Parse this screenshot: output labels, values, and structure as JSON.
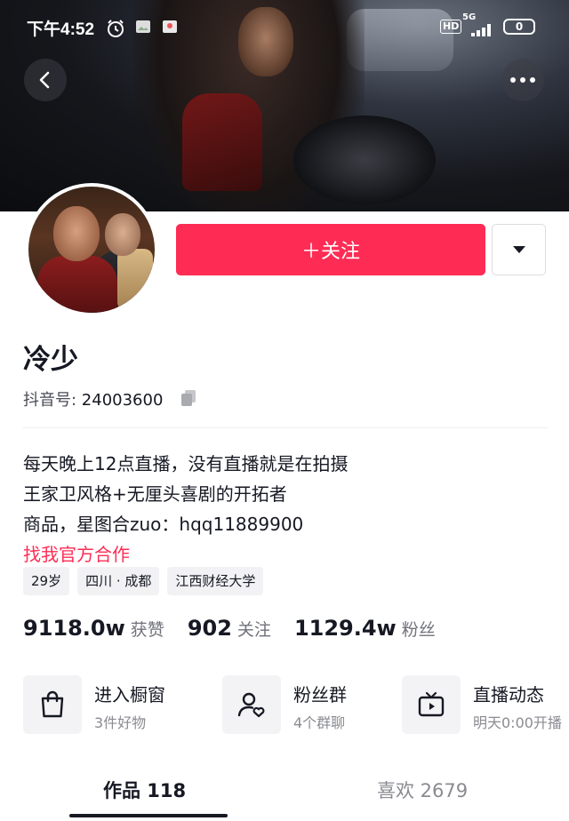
{
  "status_bar": {
    "time": "下午4:52",
    "network_badge": "HD",
    "signal_label": "5G",
    "battery": "0"
  },
  "header": {
    "back_icon": "chevron-left-icon",
    "more_icon": "more-horizontal-icon"
  },
  "profile": {
    "follow_label": "＋关注",
    "dropdown_icon": "caret-down-icon",
    "nickname": "冷少",
    "douyin_id_label": "抖音号: ",
    "douyin_id": "24003600",
    "bio_lines": [
      "每天晚上12点直播，没有直播就是在拍摄",
      "王家卫风格+无厘头喜剧的开拓者",
      "商品，星图合zuo：hqq11889900"
    ],
    "bio_link": "找我官方合作",
    "tags": [
      "29岁",
      "四川 · 成都",
      "江西财经大学"
    ]
  },
  "stats": {
    "likes": {
      "value": "9118.0w",
      "label": "获赞"
    },
    "following": {
      "value": "902",
      "label": "关注"
    },
    "followers": {
      "value": "1129.4w",
      "label": "粉丝"
    }
  },
  "entries": [
    {
      "icon": "shopping-bag-icon",
      "title": "进入橱窗",
      "subtitle": "3件好物"
    },
    {
      "icon": "fan-group-icon",
      "title": "粉丝群",
      "subtitle": "4个群聊"
    },
    {
      "icon": "live-tv-icon",
      "title": "直播动态",
      "subtitle": "明天0:00开播"
    }
  ],
  "tabs": [
    {
      "label": "作品 118",
      "active": true
    },
    {
      "label": "喜欢 2679",
      "active": false
    }
  ],
  "colors": {
    "accent": "#fe2c55",
    "text_primary": "#161823",
    "text_secondary": "#8a8b91",
    "tag_bg": "#f2f2f4"
  }
}
